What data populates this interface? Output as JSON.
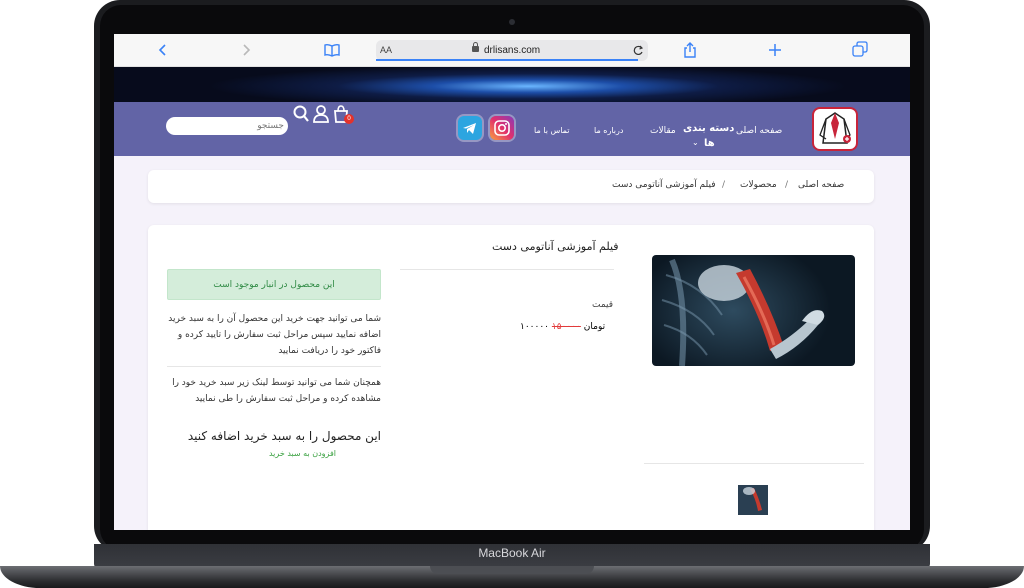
{
  "device": {
    "label": "MacBook Air"
  },
  "browser": {
    "text_size_label": "AA",
    "url": "drlisans.com"
  },
  "nav": {
    "home": "صفحه اصلی",
    "categories_line1": "دسته بندی",
    "categories_line2": "ها",
    "articles": "مقالات",
    "about": "درباره ما",
    "contact": "تماس با ما"
  },
  "header": {
    "search_placeholder": "جستجو",
    "cart_count": "0"
  },
  "breadcrumb": {
    "home": "صفحه اصلی",
    "separator": "/",
    "products": "محصولات",
    "current": "فیلم آموزشی آناتومی دست"
  },
  "product": {
    "title": "فیلم آموزشی آناتومی دست",
    "price_label": "قیمت",
    "old_price": "۱۵۰۰۰۰",
    "new_price": "۱۰۰۰۰۰ تومان"
  },
  "sidebar": {
    "stock_status": "این محصول در انبار موجود است",
    "info_1": "شما می توانید جهت خرید این محصول آن را به سبد خرید اضافه نمایید سپس مراحل ثبت سفارش را تایید کرده و فاکتور خود را دریافت نمایید",
    "info_2": "همچنان شما می توانید توسط لینک زیر سبد خرید خود را مشاهده کرده و مراحل ثبت سفارش را طی نمایید",
    "add_to_cart_title": "این محصول را به سبد خرید اضافه کنید",
    "add_to_cart_link": "افزودن به سبد خرید"
  },
  "colors": {
    "navbar": "#6264a6",
    "accent": "#3a82f7",
    "success_bg": "#d4edda",
    "success_text": "#2f8a44",
    "old_price": "#e23b3b"
  }
}
